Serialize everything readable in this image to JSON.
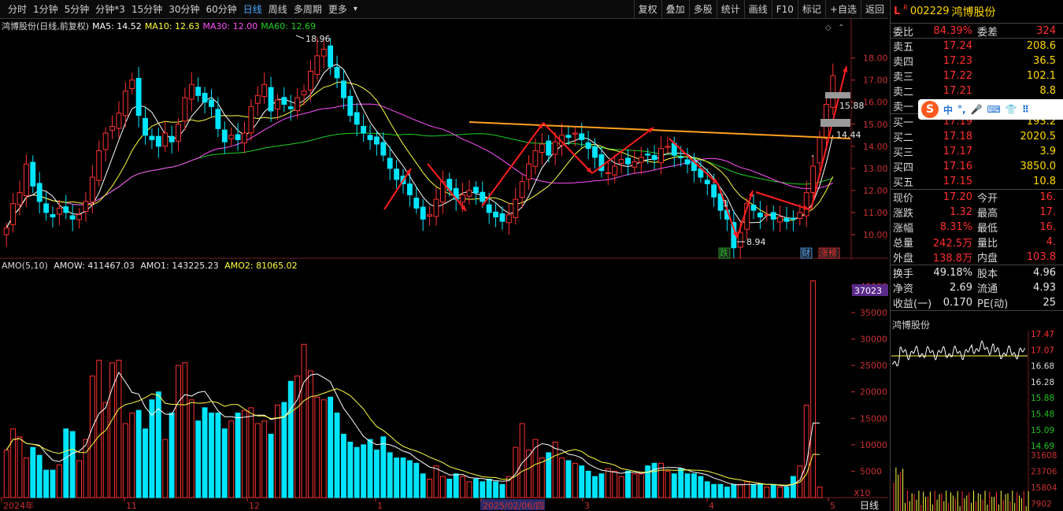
{
  "toolbar": {
    "periods": [
      "分时",
      "1分钟",
      "5分钟",
      "分钟*3",
      "15分钟",
      "30分钟",
      "60分钟",
      "日线",
      "周线",
      "多周期",
      "更多"
    ],
    "active_period": "日线",
    "right_buttons": [
      "复权",
      "叠加",
      "多股",
      "统计",
      "画线",
      "F10",
      "标记",
      "+自选",
      "返回"
    ]
  },
  "ma_legend": {
    "title": "鸿博股份(日线,前复权)",
    "ma5": "MA5: 14.52",
    "ma10": "MA10: 12.63",
    "ma30": "MA30: 12.00",
    "ma60": "MA60: 12.69"
  },
  "price_axis": {
    "ticks": [
      "18.00",
      "17.00",
      "16.00",
      "15.00",
      "14.00",
      "13.00",
      "12.00",
      "11.00",
      "10.00"
    ],
    "range": [
      9.0,
      19.2
    ]
  },
  "price_annotations": {
    "high": "18.96",
    "low": "8.94",
    "last_high": "15.88",
    "last_low": "14.44",
    "marker_1": "1",
    "marker_dash": "-",
    "flags": [
      "跌",
      "财",
      "涨榜"
    ]
  },
  "amo_legend": {
    "title": "AMO(5,10)",
    "amow": "AMOW: 411467.03",
    "amo1": "AMO1: 143225.23",
    "amo2": "AMO2: 81065.02"
  },
  "vol_axis": {
    "ticks": [
      "40000",
      "35000",
      "30000",
      "25000",
      "20000",
      "15000",
      "10000",
      "5000"
    ],
    "highlight": "37023",
    "unit": "X10"
  },
  "x_axis": {
    "labels": [
      "2024年",
      "11",
      "12",
      "1",
      "2025/02/06/四",
      "3",
      "4",
      "5"
    ],
    "period_label": "日线"
  },
  "chart_data": {
    "type": "candlestick",
    "series_colors": {
      "up": "#ff3030",
      "down": "#00e5ff",
      "ma5": "#ffffff",
      "ma10": "#ffff40",
      "ma30": "#ff50ff",
      "ma60": "#20d020"
    },
    "close": [
      10.3,
      11.4,
      11.9,
      13.2,
      12.2,
      11.5,
      11.0,
      10.8,
      11.2,
      11.0,
      10.7,
      10.9,
      11.5,
      12.6,
      13.8,
      14.6,
      14.9,
      15.5,
      16.5,
      17.0,
      15.4,
      14.5,
      14.3,
      14.0,
      14.6,
      14.2,
      15.0,
      16.2,
      16.8,
      16.3,
      16.0,
      15.8,
      14.8,
      14.2,
      14.5,
      14.3,
      14.6,
      15.8,
      16.3,
      16.8,
      15.6,
      16.1,
      15.9,
      15.7,
      16.2,
      16.5,
      17.4,
      18.1,
      18.4,
      17.6,
      17.1,
      16.2,
      15.4,
      15.0,
      14.6,
      14.3,
      14.1,
      13.6,
      13.0,
      12.5,
      12.3,
      11.8,
      11.2,
      10.7,
      10.9,
      11.6,
      12.4,
      12.0,
      11.6,
      11.8,
      12.0,
      11.9,
      11.5,
      11.0,
      10.8,
      10.6,
      10.9,
      11.6,
      12.4,
      13.2,
      13.8,
      14.1,
      13.6,
      14.2,
      14.5,
      14.4,
      14.6,
      14.3,
      13.9,
      13.5,
      12.9,
      12.8,
      13.1,
      13.4,
      13.2,
      13.3,
      13.5,
      13.6,
      13.4,
      13.9,
      14.0,
      13.6,
      13.5,
      13.2,
      12.9,
      12.6,
      12.3,
      11.7,
      11.1,
      10.7,
      9.4,
      10.1,
      11.4,
      11.1,
      10.8,
      10.9,
      10.7,
      10.8,
      10.6,
      10.7,
      11.0,
      11.9,
      13.1,
      14.4,
      15.9,
      17.2
    ],
    "amo": [
      9000,
      13000,
      11500,
      7500,
      9500,
      8000,
      5200,
      5200,
      6200,
      13000,
      12500,
      7000,
      11000,
      23000,
      26000,
      18000,
      25500,
      26000,
      14000,
      16000,
      16500,
      13000,
      18500,
      20000,
      11000,
      16000,
      25000,
      25500,
      18500,
      14500,
      17000,
      16000,
      16000,
      13000,
      14500,
      16000,
      16500,
      17000,
      14000,
      14500,
      12000,
      17500,
      18000,
      22000,
      23000,
      29000,
      24000,
      19000,
      18500,
      19000,
      16000,
      12000,
      10500,
      9500,
      10000,
      11000,
      9000,
      11500,
      8500,
      7500,
      7500,
      7000,
      6500,
      4500,
      3500,
      6000,
      4000,
      3500,
      4500,
      4000,
      3000,
      3500,
      3000,
      3500,
      3000,
      2500,
      4000,
      9500,
      14000,
      9000,
      11000,
      7500,
      8500,
      10500,
      7500,
      7000,
      6500,
      6000,
      5000,
      4000,
      4500,
      5500,
      5000,
      4000,
      5000,
      4500,
      4500,
      6000,
      6500,
      6500,
      5000,
      4500,
      5500,
      4500,
      4500,
      4000,
      3000,
      2500,
      2500,
      2000,
      2500,
      2500,
      3000,
      2500,
      2500,
      2000,
      2500,
      2000,
      2000,
      4000,
      6000,
      17500,
      41000,
      2000
    ]
  },
  "panel": {
    "market": "L",
    "badge": "R",
    "code": "002229",
    "name": "鸿博股份",
    "weibi_label": "委比",
    "weibi": "84.39%",
    "weicha_label": "委差",
    "weicha": "324",
    "asks": [
      {
        "label": "卖五",
        "price": "17.24",
        "vol": "208.6"
      },
      {
        "label": "卖四",
        "price": "17.23",
        "vol": "36.5"
      },
      {
        "label": "卖三",
        "price": "17.22",
        "vol": "102.1"
      },
      {
        "label": "卖二",
        "price": "17.21",
        "vol": "8.8"
      },
      {
        "label": "卖一",
        "price": "",
        "vol": ""
      }
    ],
    "bids": [
      {
        "label": "买一",
        "price": "17.19",
        "vol": "193.2"
      },
      {
        "label": "买二",
        "price": "17.18",
        "vol": "2020.5"
      },
      {
        "label": "买三",
        "price": "17.17",
        "vol": "3.9"
      },
      {
        "label": "买四",
        "price": "17.16",
        "vol": "3850.0"
      },
      {
        "label": "买五",
        "price": "17.15",
        "vol": "10.8"
      }
    ],
    "stats": [
      {
        "l1": "现价",
        "v1": "17.20",
        "l2": "今开",
        "v2": "16."
      },
      {
        "l1": "涨跌",
        "v1": "1.32",
        "l2": "最高",
        "v2": "17."
      },
      {
        "l1": "涨幅",
        "v1": "8.31%",
        "l2": "最低",
        "v2": "16."
      },
      {
        "l1": "总量",
        "v1": "242.5万",
        "l2": "量比",
        "v2": "4."
      },
      {
        "l1": "外盘",
        "v1": "138.8万",
        "l2": "内盘",
        "v2": "103.8"
      }
    ],
    "stats2": [
      {
        "l1": "换手",
        "v1": "49.18%",
        "l2": "股本",
        "v2": "4.96"
      },
      {
        "l1": "净资",
        "v1": "2.69",
        "l2": "流通",
        "v2": "4.93"
      },
      {
        "l1": "收益(一)",
        "v1": "0.170",
        "l2": "PE(动)",
        "v2": "25"
      }
    ],
    "sogou": {
      "logo": "S",
      "items": [
        "中",
        "°,",
        "🎤",
        "⌨",
        "👕",
        "⠿"
      ]
    },
    "mini_title": "鸿博股份",
    "mini_ticks": [
      "17.47",
      "17.07",
      "16.68",
      "16.28",
      "15.88",
      "15.48",
      "15.09",
      "14.69",
      "31608",
      "23706",
      "15804",
      "7902"
    ]
  }
}
